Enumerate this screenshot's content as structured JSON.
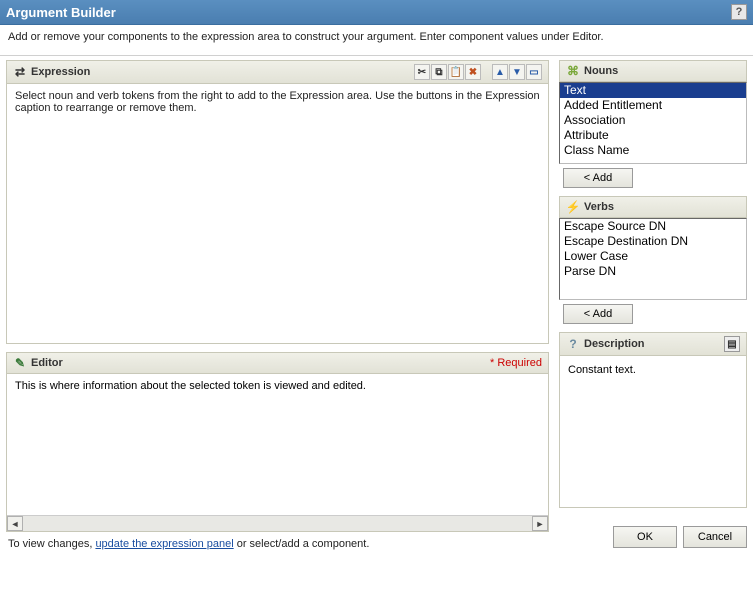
{
  "title": "Argument Builder",
  "subtitle": "Add or remove your components to the expression area to construct your argument. Enter component values under Editor.",
  "expression": {
    "header": "Expression",
    "hint": "Select noun and verb tokens from the right to add to the Expression area. Use the buttons in the Expression caption to rearrange or remove them."
  },
  "editor": {
    "header": "Editor",
    "required_label": "* Required",
    "hint": "This is where information about the selected token is viewed and edited."
  },
  "footer": {
    "prefix": "To view changes, ",
    "link": "update the expression panel",
    "suffix": " or select/add a component."
  },
  "nouns": {
    "header": "Nouns",
    "items": [
      "Text",
      "Added Entitlement",
      "Association",
      "Attribute",
      "Class Name"
    ],
    "selected_index": 0,
    "add_label": "<  Add"
  },
  "verbs": {
    "header": "Verbs",
    "items": [
      "Escape Source DN",
      "Escape Destination DN",
      "Lower Case",
      "Parse DN"
    ],
    "selected_index": -1,
    "add_label": "<  Add"
  },
  "description": {
    "header": "Description",
    "text": "Constant text."
  },
  "buttons": {
    "ok": "OK",
    "cancel": "Cancel"
  }
}
